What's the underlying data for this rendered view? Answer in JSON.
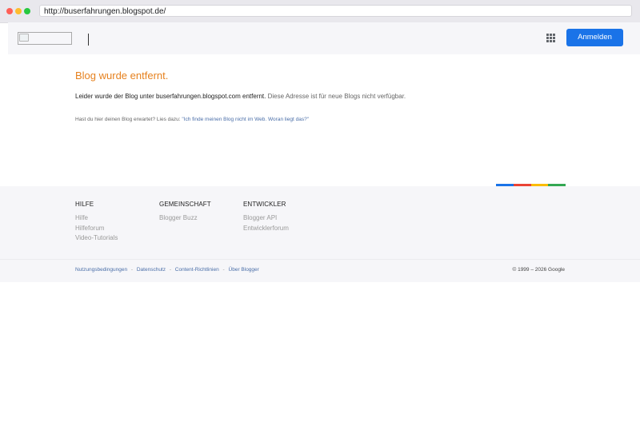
{
  "browser": {
    "url": "http://buserfahrungen.blogspot.de/"
  },
  "header": {
    "signin_label": "Anmelden",
    "apps_icon": "apps-grid-icon"
  },
  "main": {
    "title": "Blog wurde entfernt.",
    "message_strong": "Leider wurde der Blog unter buserfahrungen.blogspot.com entfernt.",
    "message_muted": "Diese Adresse ist für neue Blogs nicht verfügbar.",
    "help_prefix": "Hast du hier deinen Blog erwartet? Lies dazu:",
    "help_link": "\"Ich finde meinen Blog nicht im Web. Woran liegt das?\""
  },
  "color_strip": [
    "#1a73e8",
    "#ea4335",
    "#fbbc04",
    "#34a853"
  ],
  "footer": {
    "columns": [
      {
        "heading": "HILFE",
        "links": [
          "Hilfe",
          "Hilfeforum",
          "Video-Tutorials"
        ]
      },
      {
        "heading": "GEMEINSCHAFT",
        "links": [
          "Blogger Buzz"
        ]
      },
      {
        "heading": "ENTWICKLER",
        "links": [
          "Blogger API",
          "Entwicklerforum"
        ]
      }
    ],
    "legal_links": [
      "Nutzungsbedingungen",
      "Datenschutz",
      "Content-Richtlinien",
      "Über Blogger"
    ],
    "separator": "-",
    "copyright": "© 1999 – 2026 Google"
  },
  "colors": {
    "accent": "#e6811e",
    "signin_button": "#1a73e8",
    "link": "#4a6ea8"
  }
}
